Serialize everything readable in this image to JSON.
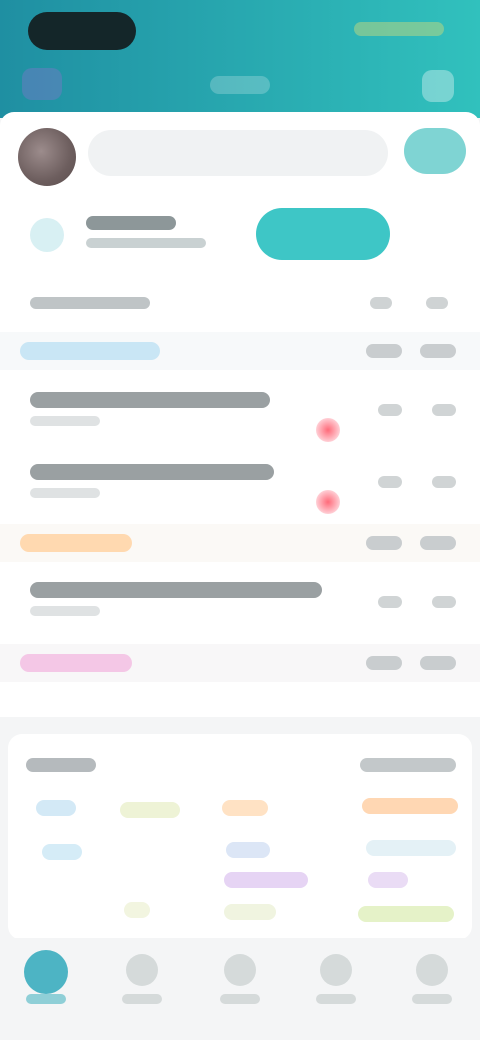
{
  "colors": {
    "header_gradient_start": "#1f8fa2",
    "header_gradient_end": "#31c1bd",
    "accent": "#3ec6c6",
    "alert": "#ff6b7a",
    "category_blue": "#8fd0f0",
    "category_orange": "#ffc58a",
    "category_pink": "#f0a6d8",
    "background": "#f4f5f6"
  },
  "icons": {
    "header_left": "menu-icon",
    "header_right": "profile-icon",
    "avatar": "avatar-image",
    "info": "info-icon",
    "alert": "alert-dot-icon",
    "tabs": [
      "home-icon",
      "list-icon",
      "grid-icon",
      "chart-icon",
      "user-icon"
    ]
  },
  "rows": [
    {
      "category_color": "blue"
    },
    {
      "has_alert": true
    },
    {
      "has_alert": true
    },
    {
      "category_color": "orange"
    },
    {
      "has_alert": false
    },
    {
      "category_color": "pink"
    }
  ],
  "tabs_active_index": 0
}
